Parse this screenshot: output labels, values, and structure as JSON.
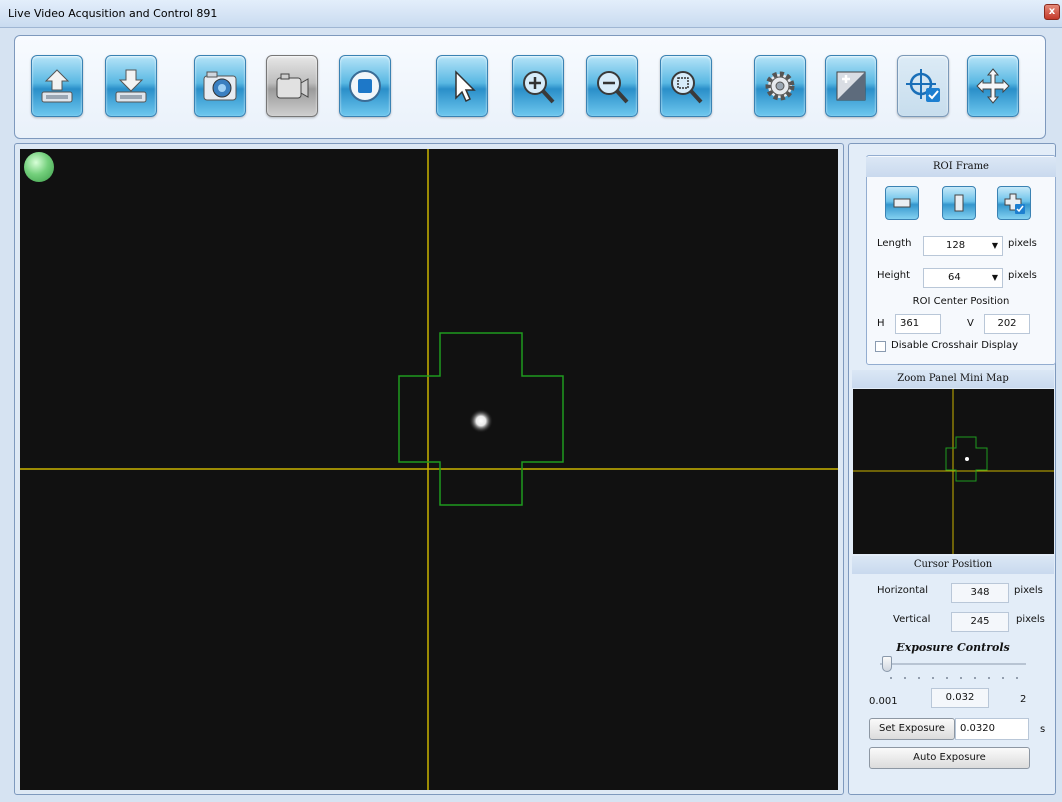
{
  "window": {
    "title": "Live Video Acqusition and Control  891",
    "close_label": "x"
  },
  "toolbar": {
    "buttons": [
      {
        "icon": "upload-icon"
      },
      {
        "icon": "download-icon"
      },
      {
        "icon": "camera-icon"
      },
      {
        "icon": "video-camera-icon"
      },
      {
        "icon": "stop-icon"
      },
      {
        "icon": "pointer-icon"
      },
      {
        "icon": "zoom-in-icon"
      },
      {
        "icon": "zoom-out-icon"
      },
      {
        "icon": "zoom-fit-icon"
      },
      {
        "icon": "settings-gear-icon"
      },
      {
        "icon": "exposure-icon"
      },
      {
        "icon": "crosshair-icon"
      },
      {
        "icon": "move-icon"
      }
    ]
  },
  "roi": {
    "title": "ROI Frame",
    "length_label": "Length",
    "length_value": "128",
    "length_unit": "pixels",
    "height_label": "Height",
    "height_value": "64",
    "height_unit": "pixels",
    "center_label": "ROI Center Position",
    "h_label": "H",
    "h_value": "361",
    "v_label": "V",
    "v_value": "202",
    "disable_crosshair_label": "Disable Crosshair Display",
    "disable_crosshair_checked": false
  },
  "minimap": {
    "title": "Zoom Panel Mini Map"
  },
  "cursor": {
    "title": "Cursor Position",
    "horizontal_label": "Horizontal",
    "horizontal_value": "348",
    "horizontal_unit": "pixels",
    "vertical_label": "Vertical",
    "vertical_value": "245",
    "vertical_unit": "pixels"
  },
  "exposure": {
    "title": "Exposure Controls",
    "min_label": "0.001",
    "current_value": "0.032",
    "max_label": "2",
    "set_button_label": "Set Exposure",
    "set_value": "0.0320",
    "unit": "s",
    "auto_button_label": "Auto Exposure"
  },
  "colors": {
    "crosshair": "#c9b400",
    "roi_outline": "#1f9a1f",
    "video_background": "#111111",
    "status_led": "#74d07c"
  }
}
